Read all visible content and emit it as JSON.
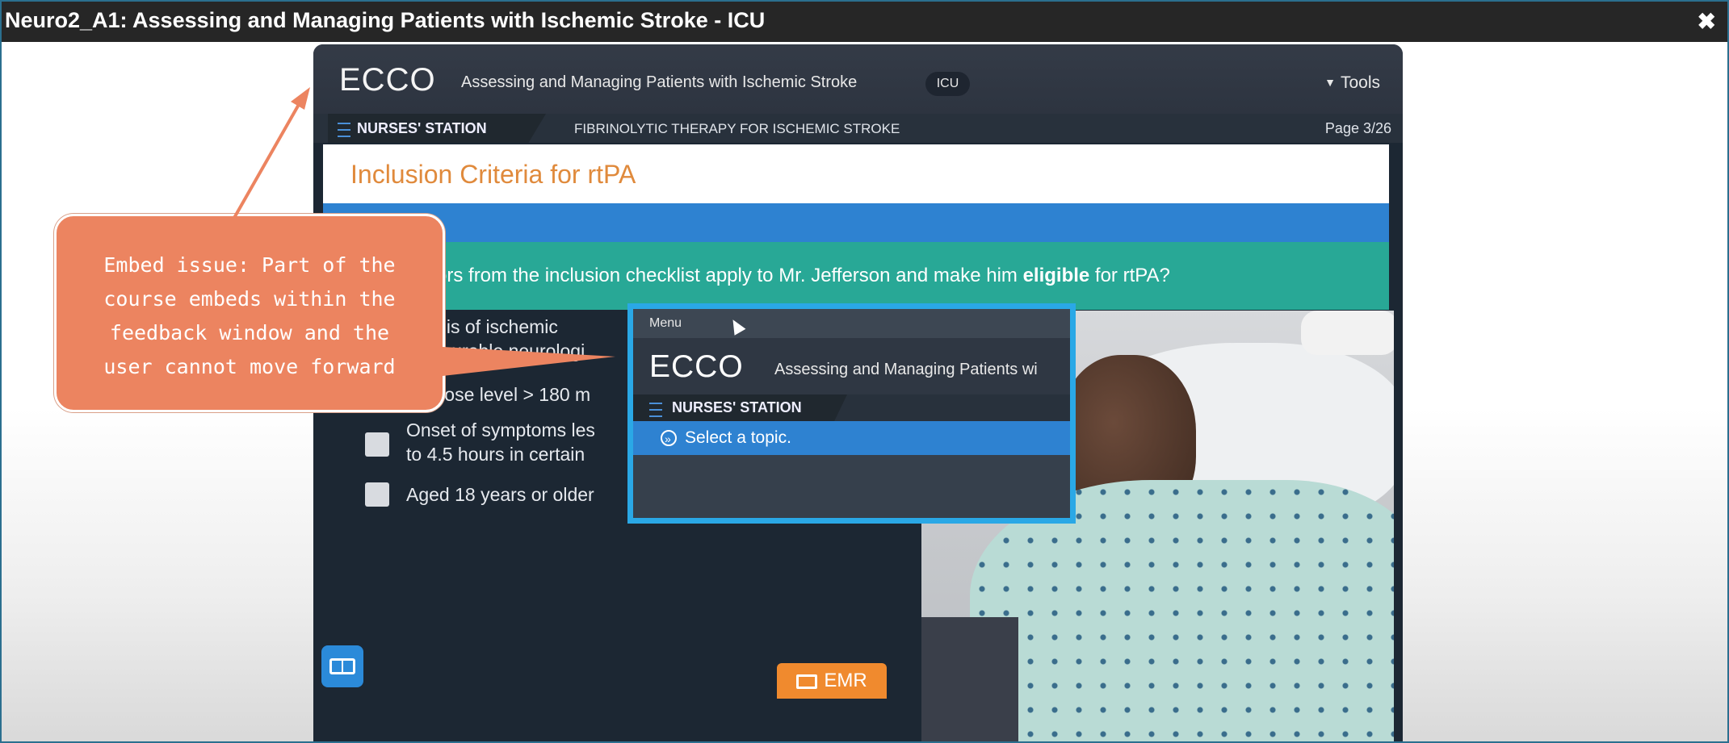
{
  "window": {
    "title": "Neuro2_A1: Assessing and Managing Patients with Ischemic Stroke - ICU",
    "close_glyph": "✖"
  },
  "course": {
    "logo": "ECCO",
    "title": "Assessing and Managing Patients with Ischemic Stroke",
    "unit_badge": "ICU",
    "tools_label": "Tools",
    "nav_label": "NURSES' STATION",
    "topic": "FIBRINOLYTIC THERAPY FOR ISCHEMIC STROKE",
    "page": "Page 3/26",
    "heading": "Inclusion Criteria for rtPA",
    "question_pre": "actors from the inclusion checklist apply to Mr. Jefferson and make him ",
    "question_bold": "eligible",
    "question_post": " for rtPA?",
    "checklist": {
      "item1_line1": "gnosis of ischemic",
      "item1_line2": "measurable neurologi",
      "item2": "Glucose level > 180 m",
      "item3_line1": "Onset of symptoms les",
      "item3_line2": "to 4.5 hours in certain",
      "item4": "Aged 18 years or older"
    },
    "emr_label": "EMR",
    "book_icon": "book-icon"
  },
  "embedded": {
    "menu_label": "Menu",
    "logo": "ECCO",
    "title": "Assessing and Managing Patients wi",
    "nav_label": "NURSES' STATION",
    "topic_prompt": "Select a topic."
  },
  "callout": {
    "line1": "Embed issue: Part of the",
    "line2": "course embeds within the",
    "line3": "feedback window and the",
    "line4": "user cannot move forward",
    "color": "#ec8460"
  },
  "colors": {
    "accent_blue": "#2e82d1",
    "teal": "#28a896",
    "heading_orange": "#e08a3c",
    "embed_border": "#2aa8e6"
  }
}
